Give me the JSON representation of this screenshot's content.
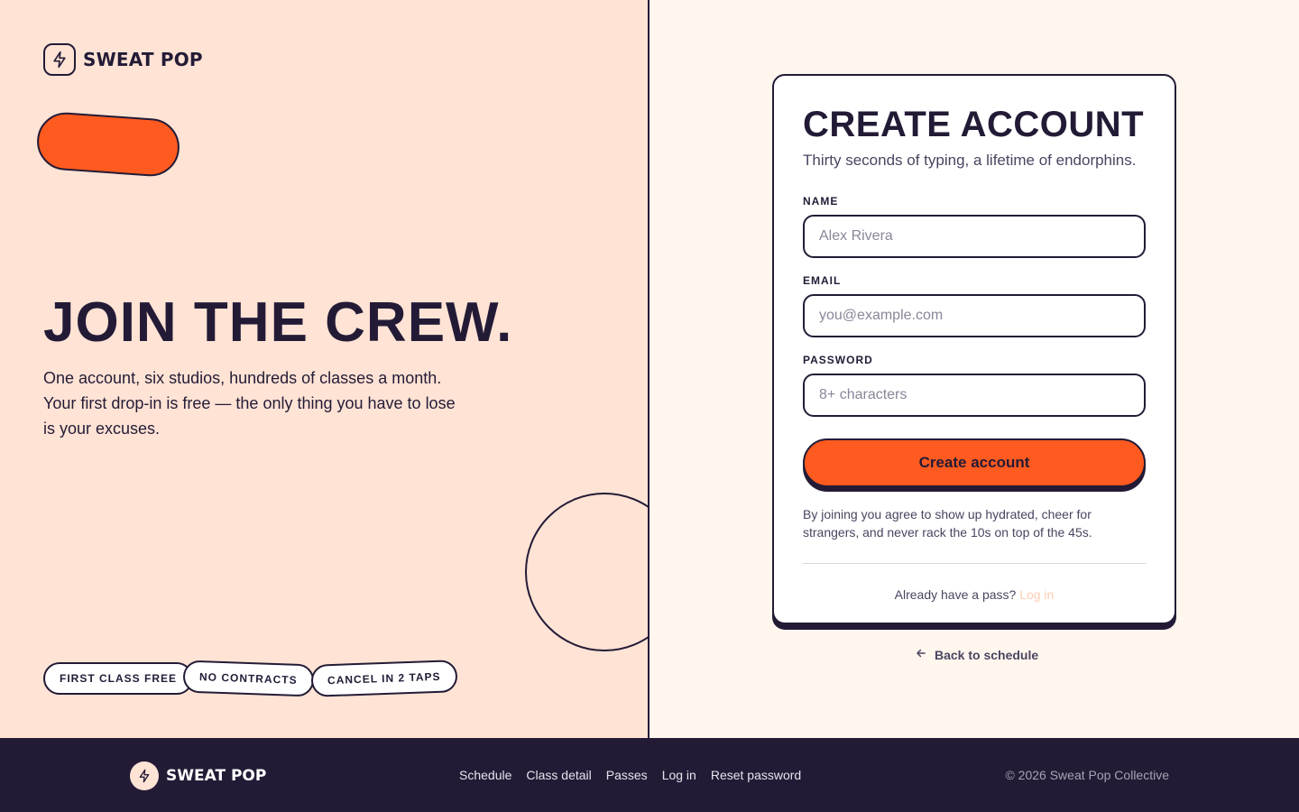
{
  "brand": {
    "name": "SWEAT POP",
    "mark_icon": "bolt-icon"
  },
  "hero": {
    "title": "JOIN THE CREW.",
    "body": "One account, six studios, hundreds of classes a month. Your first drop-in is free — the only thing you have to lose is your excuses."
  },
  "chips": [
    "FIRST CLASS FREE",
    "NO CONTRACTS",
    "CANCEL IN 2 TAPS"
  ],
  "form": {
    "title": "CREATE ACCOUNT",
    "subtitle": "Thirty seconds of typing, a lifetime of endorphins.",
    "name_label": "NAME",
    "name_placeholder": "Alex Rivera",
    "email_label": "EMAIL",
    "email_placeholder": "you@example.com",
    "password_label": "PASSWORD",
    "password_placeholder": "8+ characters",
    "submit_label": "Create account",
    "legal": "By joining you agree to show up hydrated, cheer for strangers, and never rack the 10s on top of the 45s.",
    "login_prompt": "Already have a pass?",
    "login_link": "Log in"
  },
  "back_link": "Back to schedule",
  "footer": {
    "brand": "SWEAT POP",
    "nav": [
      "Schedule",
      "Class detail",
      "Passes",
      "Log in",
      "Reset password"
    ],
    "copyright": "© 2026 Sweat Pop Collective"
  },
  "colors": {
    "ink": "#231b36",
    "accent": "#ff5a1f",
    "peach": "#ffe3d5",
    "cream": "#fff6ee",
    "link_muted": "#ffcdb5"
  }
}
